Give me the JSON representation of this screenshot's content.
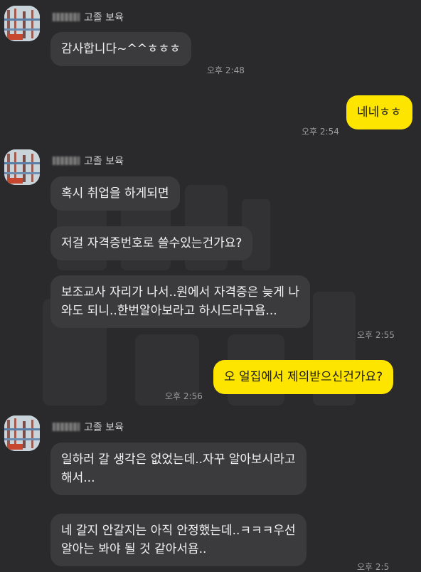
{
  "messages": [
    {
      "sender_title": "고졸 보육",
      "text": "감사합니다~^^ㅎㅎㅎ",
      "time": "오후 2:48"
    },
    {
      "text": "네네ㅎㅎ",
      "time": "오후 2:54"
    },
    {
      "sender_title": "고졸 보육",
      "text": "혹시 취업을 하게되면"
    },
    {
      "text": "저걸 자격증번호로 쓸수있는건가요?"
    },
    {
      "line1": "보조교사 자리가 나서..원에서 자격증은 늦게 나",
      "line2": "와도 되니..한번알아보라고 하시드라구욤...",
      "time": "오후 2:55"
    },
    {
      "text": "오 얼집에서 제의받으신건가요?",
      "time": "오후 2:56"
    },
    {
      "sender_title": "고졸 보육",
      "line1": "일하러 갈 생각은 없었는데..자꾸 알아보시라고",
      "line2": "해서..."
    },
    {
      "line1": "네 갈지 안갈지는 아직 안정했는데..ㅋㅋㅋ우선",
      "line2": "알아는 봐야 될 것 같아서욤..",
      "time": "오후 2:5"
    }
  ],
  "colors": {
    "background": "#2a2a2c",
    "incoming": "#3b3b3d",
    "outgoing": "#fee500"
  }
}
